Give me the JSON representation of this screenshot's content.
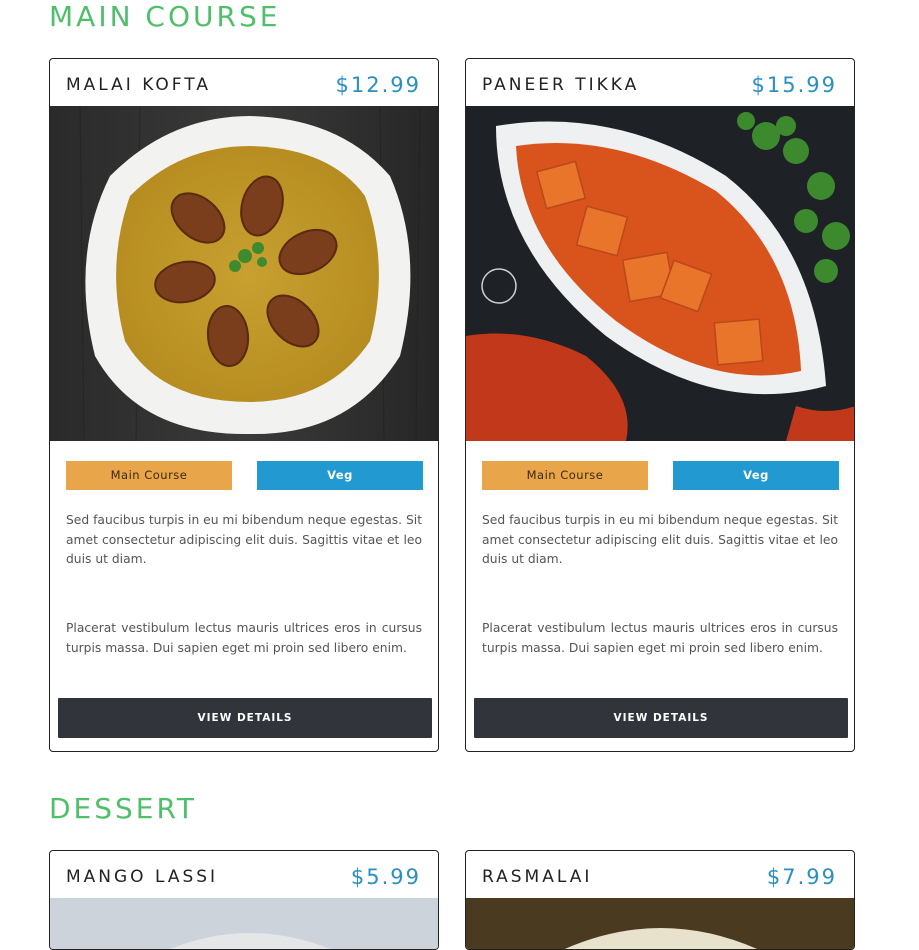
{
  "sections": [
    {
      "title": "MAIN COURSE",
      "items": [
        {
          "name": "MALAI KOFTA",
          "price": "$12.99",
          "category": "Main Course",
          "diet": "Veg",
          "desc1": "Sed faucibus turpis in eu mi bibendum neque egestas. Sit amet consectetur adipiscing elit duis. Sagittis vitae et leo duis ut diam.",
          "desc2": "Placerat vestibulum lectus mauris ultrices eros in cursus turpis massa. Dui sapien eget mi proin sed libero enim.",
          "button": "VIEW DETAILS"
        },
        {
          "name": "PANEER TIKKA",
          "price": "$15.99",
          "category": "Main Course",
          "diet": "Veg",
          "desc1": "Sed faucibus turpis in eu mi bibendum neque egestas. Sit amet consectetur adipiscing elit duis. Sagittis vitae et leo duis ut diam.",
          "desc2": "Placerat vestibulum lectus mauris ultrices eros in cursus turpis massa. Dui sapien eget mi proin sed libero enim.",
          "button": "VIEW DETAILS"
        }
      ]
    },
    {
      "title": "DESSERT",
      "items": [
        {
          "name": "MANGO LASSI",
          "price": "$5.99"
        },
        {
          "name": "RASMALAI",
          "price": "$7.99"
        }
      ]
    }
  ],
  "colors": {
    "section_title": "#4fbf6a",
    "price": "#2a8fc4",
    "category_tag": "#e8a54a",
    "diet_tag": "#2299d0",
    "button": "#31353b"
  }
}
